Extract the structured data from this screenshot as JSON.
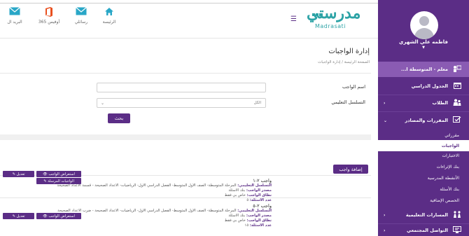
{
  "header": {
    "logo_text": "مدرستي",
    "logo_latin": "Madrasati",
    "nav": [
      {
        "label": "الرئيسة",
        "icon": "home-icon"
      },
      {
        "label": "رسائلي",
        "icon": "mail-icon"
      },
      {
        "label": "أوفيس 365",
        "icon": "office-icon"
      },
      {
        "label": "البريد ال",
        "icon": "mail-icon"
      }
    ]
  },
  "sidebar": {
    "user_name": "فاطمه علي الشهري",
    "role": "معلم - المتوسطة ا...",
    "items": [
      {
        "label": "الجدول الدراسي",
        "icon": "calendar-icon"
      },
      {
        "label": "الطلاب",
        "icon": "students-icon"
      },
      {
        "label": "المقررات والمصادر",
        "icon": "courses-icon"
      }
    ],
    "sub_items": [
      {
        "label": "مقرراتي"
      },
      {
        "label": "الواجبات"
      },
      {
        "label": "الاختبارات"
      },
      {
        "label": "بنك الإثراءات"
      },
      {
        "label": "الأنشطة المدرسية"
      },
      {
        "label": "بنك الأسئلة"
      },
      {
        "label": "الحصص الإضافية"
      }
    ],
    "bottom_items": [
      {
        "label": "المسارات التعليمية",
        "icon": "paths-icon"
      },
      {
        "label": "التواصل المجتمعي",
        "icon": "community-icon"
      }
    ]
  },
  "page": {
    "title": "إدارة الواجبات",
    "breadcrumb_home": "الصفحة الرئيسة",
    "breadcrumb_sep": "/",
    "breadcrumb_current": "إدارة الواجبات"
  },
  "form": {
    "name_label": "اسم الواجب",
    "series_label": "التسلسل التعليمي",
    "series_value": "الكل",
    "search_button": "بحث"
  },
  "add_button": "إضافة واجب",
  "homeworks": [
    {
      "title": "واجب ٢-١",
      "series_label": "التسلسل التعليمي:",
      "series_value": "المرحلة المتوسطة- الصف الأول المتوسط- الفصل الدراسي الأول- الرياضيات- الأعداد الصحيحة - قسمة الأعداد الصحيحة",
      "source_label": "مصدر الواجب:",
      "source_value": "بنك الأسئلة",
      "scope_label": "نطاق الواجب:",
      "scope_value": "خاص بي فقط",
      "count_label": "عدد الأسئلة:",
      "count_value": "٥",
      "view_button": "استعراض الواجب",
      "edit_button": "تعديل",
      "submitted_button": "الواجبات المرسلة"
    },
    {
      "title": "واجب ٢-٥",
      "series_label": "التسلسل التعليمي:",
      "series_value": "المرحلة المتوسطة- الصف الأول المتوسط- الفصل الدراسي الأول- الرياضيات- الأعداد الصحيحة - ضرب الأعداد الصحيحة",
      "source_label": "مصدر الواجب:",
      "source_value": "بنك الأسئلة",
      "scope_label": "نطاق الواجب:",
      "scope_value": "خاص بي فقط",
      "count_label": "عدد الأسئلة:",
      "count_value": "١٥",
      "view_button": "استعراض الواجب",
      "edit_button": "تعديل"
    }
  ],
  "colors": {
    "brand": "#5b2d86",
    "brand_light": "#8a5bb3",
    "logo": "#2da3a6"
  }
}
